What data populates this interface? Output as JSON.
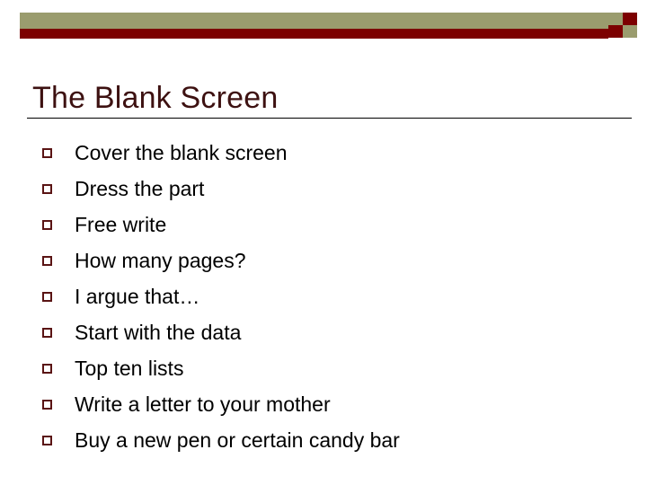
{
  "slide": {
    "title": "The Blank Screen",
    "theme": {
      "olive": "#9a9c6e",
      "maroon": "#7c0000",
      "title_color": "#3d1111",
      "bullet_color": "#5a1414",
      "text_color": "#000000",
      "background": "#ffffff",
      "rule_color": "#000000"
    },
    "banner": {
      "olive_bar_name": "olive-bar",
      "maroon_bar_name": "maroon-bar",
      "checker_name": "checker-accent"
    },
    "bullets": [
      {
        "text": "Cover the blank screen"
      },
      {
        "text": "Dress the part"
      },
      {
        "text": "Free write"
      },
      {
        "text": "How many pages?"
      },
      {
        "text": "I argue that…"
      },
      {
        "text": "Start with the data"
      },
      {
        "text": "Top ten lists"
      },
      {
        "text": "Write a letter to your mother"
      },
      {
        "text": "Buy a new pen or certain candy bar"
      }
    ]
  }
}
